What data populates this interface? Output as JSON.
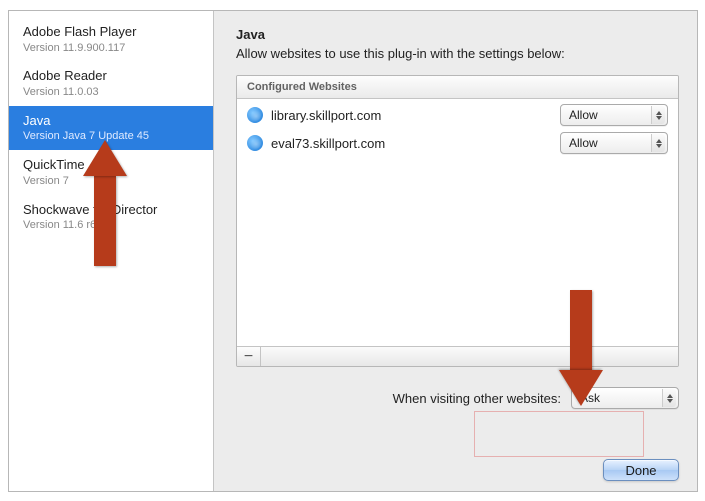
{
  "sidebar": {
    "items": [
      {
        "name": "Adobe Flash Player",
        "ver": "Version 11.9.900.117"
      },
      {
        "name": "Adobe Reader",
        "ver": "Version 11.0.03"
      },
      {
        "name": "Java",
        "ver": "Version Java 7 Update 45"
      },
      {
        "name": "QuickTime",
        "ver": "Version 7"
      },
      {
        "name": "Shockwave for Director",
        "ver": "Version 11.6 r634"
      }
    ],
    "selectedIndex": 2
  },
  "detail": {
    "title": "Java",
    "subtitle": "Allow websites to use this plug-in with the settings below:",
    "listHeader": "Configured Websites",
    "sites": [
      {
        "host": "library.skillport.com",
        "policy": "Allow"
      },
      {
        "host": "eval73.skillport.com",
        "policy": "Allow"
      }
    ],
    "removeLabel": "−",
    "otherLabel": "When visiting other websites:",
    "otherValue": "Ask"
  },
  "buttons": {
    "done": "Done"
  }
}
